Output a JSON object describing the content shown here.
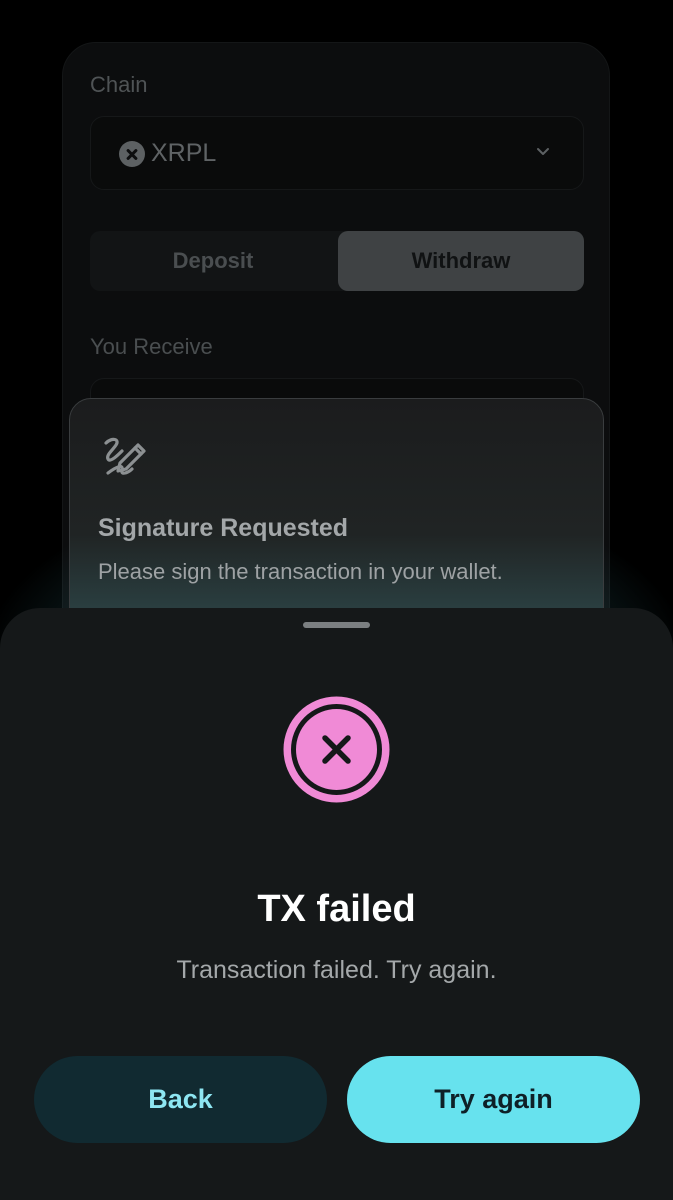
{
  "form": {
    "chain_label": "Chain",
    "chain_value": "XRPL",
    "chain_icon": "xrpl-logo-icon",
    "tabs": {
      "deposit": "Deposit",
      "withdraw": "Withdraw",
      "selected": "Withdraw"
    },
    "receive_label": "You Receive"
  },
  "signature_card": {
    "icon": "signature-pen-icon",
    "title": "Signature Requested",
    "subtitle": "Please sign the transaction in your wallet."
  },
  "sheet": {
    "status_icon": "close-circle-icon",
    "title": "TX failed",
    "message": "Transaction failed. Try again.",
    "back_label": "Back",
    "retry_label": "Try again"
  },
  "colors": {
    "accent": "#67e2ee",
    "error": "#f08ad6",
    "sheet_bg": "#151819",
    "back_button_bg": "#112a31"
  }
}
